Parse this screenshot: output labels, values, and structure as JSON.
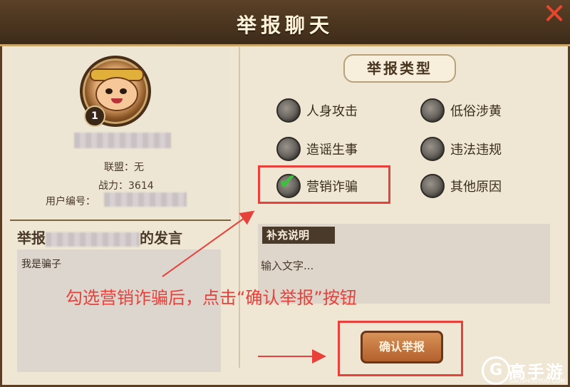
{
  "window": {
    "title": "举报聊天",
    "close_icon": "close-icon"
  },
  "player": {
    "level": "1",
    "alliance": "联盟：无",
    "power": "战力：3614",
    "user_id_label": "用户编号："
  },
  "speech": {
    "title_prefix": "举报",
    "title_suffix": "的发言",
    "content": "我是骗子"
  },
  "report_types": {
    "header": "举报类型",
    "options": [
      {
        "label": "人身攻击",
        "checked": false
      },
      {
        "label": "低俗涉黄",
        "checked": false
      },
      {
        "label": "造谣生事",
        "checked": false
      },
      {
        "label": "违法违规",
        "checked": false
      },
      {
        "label": "营销诈骗",
        "checked": true
      },
      {
        "label": "其他原因",
        "checked": false
      }
    ]
  },
  "supplement": {
    "title": "补充说明",
    "placeholder": "输入文字..."
  },
  "confirm_button": "确认举报",
  "annotation": "勾选营销诈骗后，点击“确认举报”按钮",
  "watermark": {
    "logo": "G",
    "name": "高手游",
    "domain": "GAOSHOUYOU.COM"
  },
  "colors": {
    "accent_red": "#e8403a",
    "check_green": "#38c23e",
    "button_brown": "#b4602d"
  }
}
